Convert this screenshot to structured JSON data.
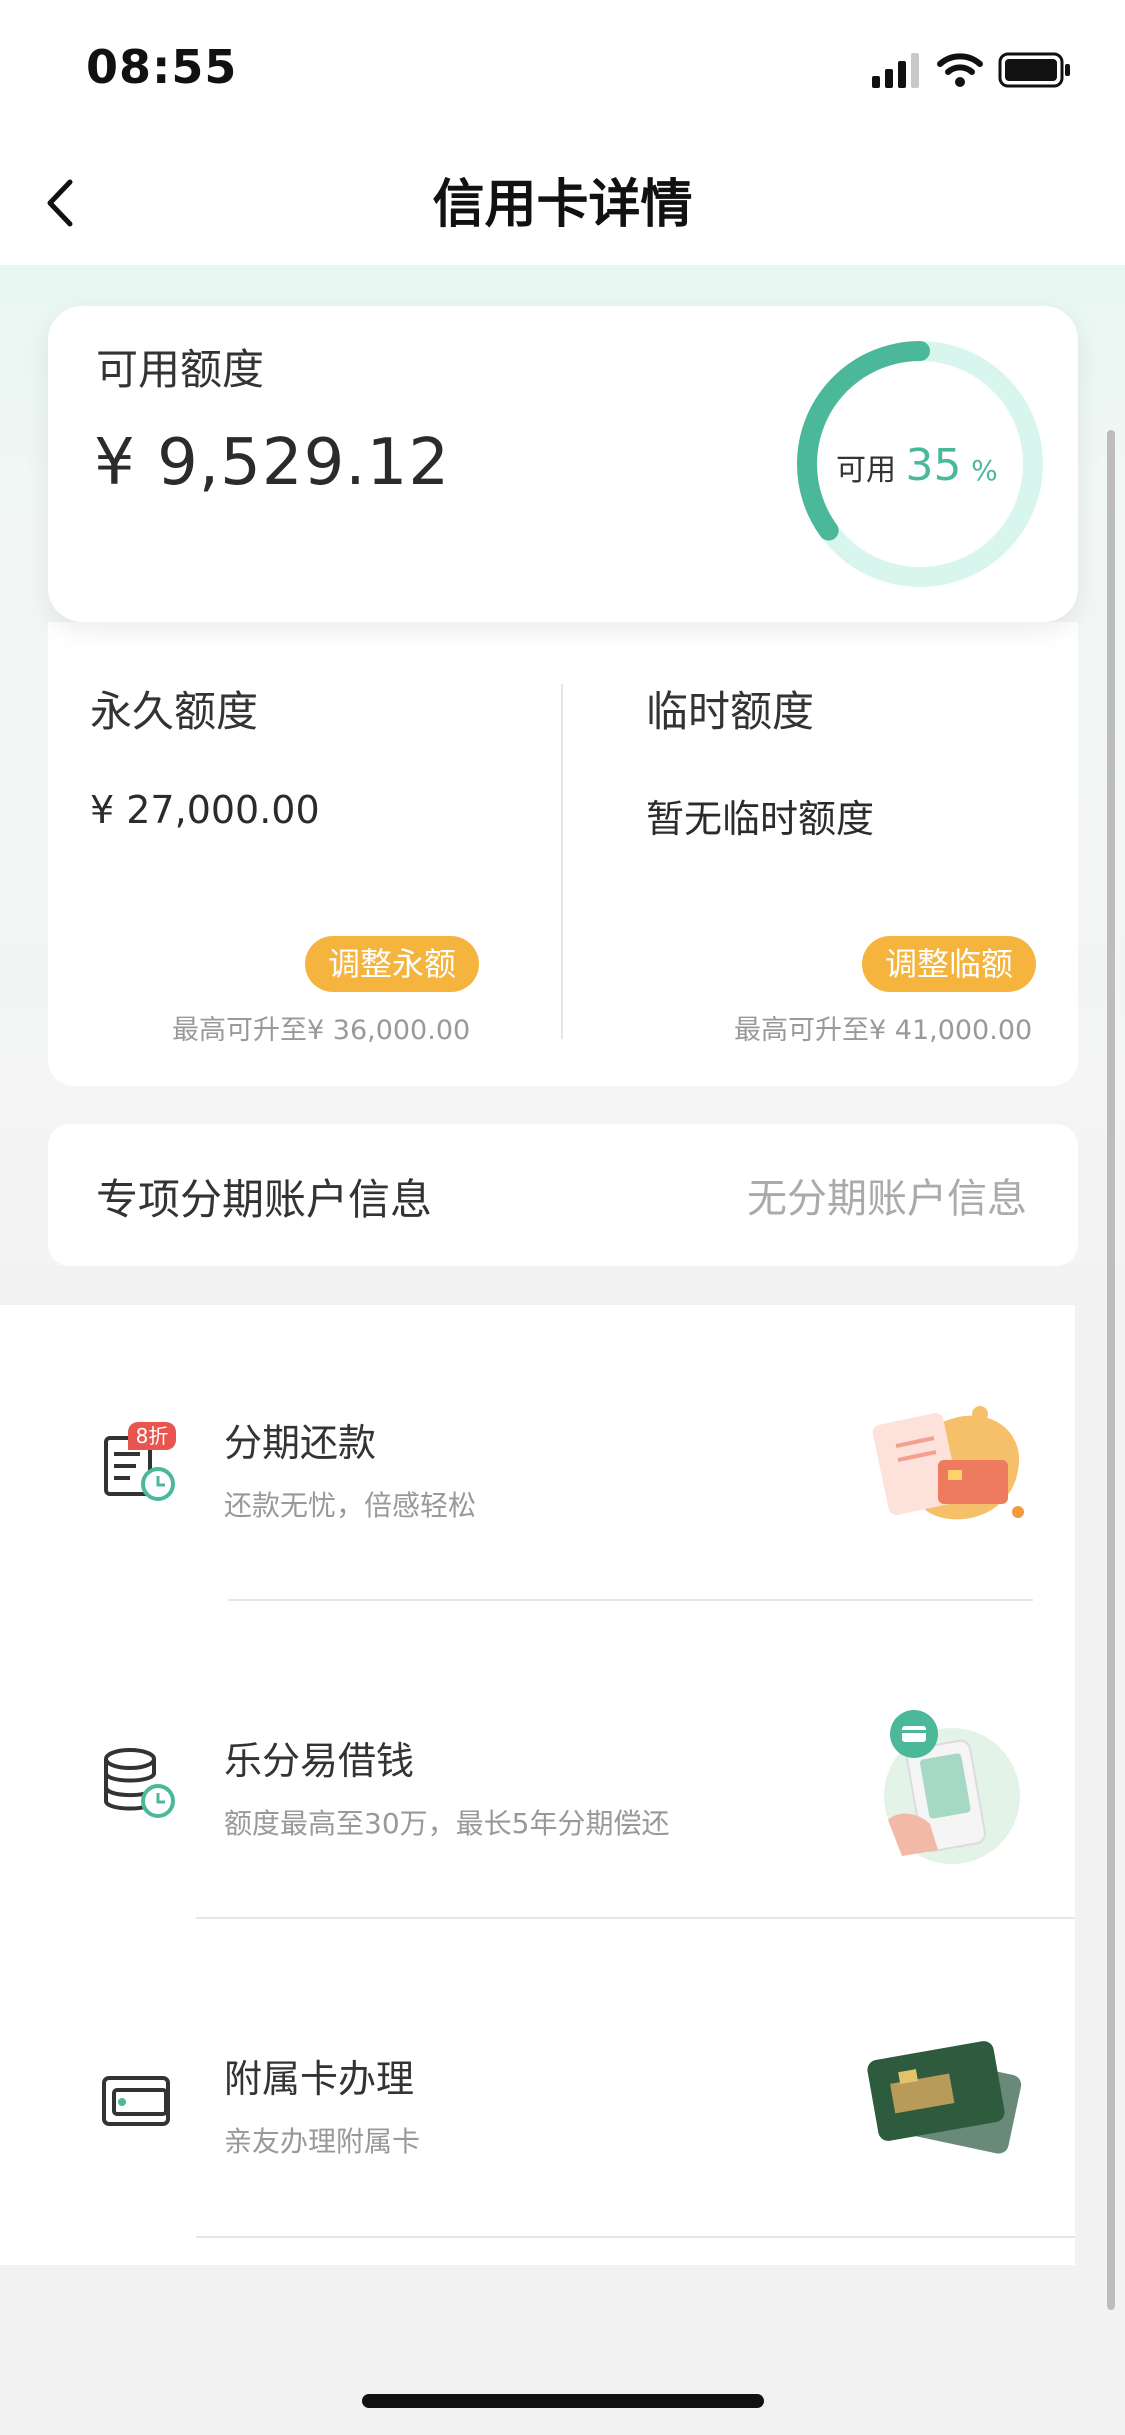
{
  "status_bar": {
    "time": "08:55"
  },
  "nav": {
    "title": "信用卡详情"
  },
  "available": {
    "label": "可用额度",
    "amount": "¥ 9,529.12",
    "ring_label": "可用",
    "ring_percent_text": "35",
    "ring_percent_sign": "%",
    "ring_fraction": 0.35
  },
  "permanent": {
    "title": "永久额度",
    "value": "¥ 27,000.00",
    "button": "调整永额",
    "note": "最高可升至¥ 36,000.00"
  },
  "temporary": {
    "title": "临时额度",
    "value": "暂无临时额度",
    "button": "调整临额",
    "note": "最高可升至¥ 41,000.00"
  },
  "installment_account": {
    "label": "专项分期账户信息",
    "value": "无分期账户信息"
  },
  "services": [
    {
      "title": "分期还款",
      "subtitle": "还款无忧，倍感轻松",
      "badge": "8折",
      "icon": "installment-bill-icon"
    },
    {
      "title": "乐分易借钱",
      "subtitle": "额度最高至30万，最长5年分期偿还",
      "icon": "coin-stack-clock-icon"
    },
    {
      "title": "附属卡办理",
      "subtitle": "亲友办理附属卡",
      "icon": "card-icon"
    }
  ],
  "colors": {
    "accent": "#4cb89a",
    "pill": "#f4b43e",
    "ring_track": "#d9f6ee"
  }
}
